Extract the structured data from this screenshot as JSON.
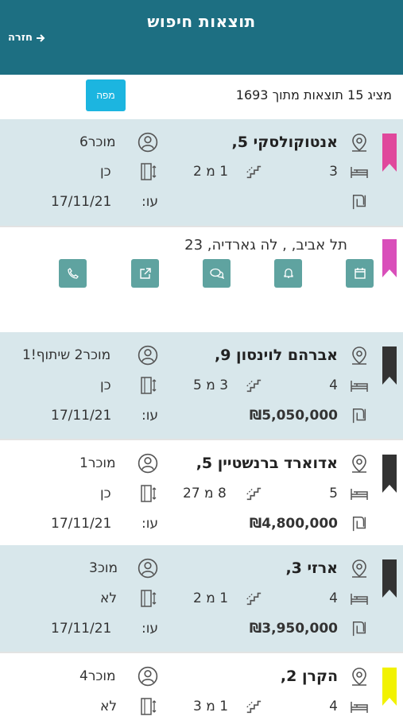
{
  "header": {
    "title": "תוצאות חיפוש",
    "back_label": "חזרה"
  },
  "summary": {
    "text": "מציג 15 תוצאות מתוך 1693",
    "map_label": "מפה"
  },
  "expanded": {
    "address": "תל אביב, , לה גארדיה, 23",
    "actions": [
      "calendar-icon",
      "bell-icon",
      "chat-icon",
      "external-link-icon",
      "phone-icon"
    ]
  },
  "listings": [
    {
      "address": "אנטוקולסקי 5,",
      "seller": "מוכר6",
      "rooms": "3",
      "floor": "1 מ 2",
      "parking": "כן",
      "price": "",
      "date": "17/11/21",
      "until": "עו:",
      "bookmark": "#e0489c"
    },
    {
      "address": "אברהם לוינסון 9,",
      "seller": "מוכר2 שיתוף!1",
      "rooms": "4",
      "floor": "3 מ 5",
      "parking": "כן",
      "price": "₪5,050,000",
      "date": "17/11/21",
      "until": "עו:",
      "bookmark": "#333333"
    },
    {
      "address": "אדוארד ברנשטיין 5,",
      "seller": "מוכר1",
      "rooms": "5",
      "floor": "8 מ 27",
      "parking": "כן",
      "price": "₪4,800,000",
      "date": "17/11/21",
      "until": "עו:",
      "bookmark": "#333333"
    },
    {
      "address": "ארזי 3,",
      "seller": "מוכ3",
      "rooms": "4",
      "floor": "1 מ 2",
      "parking": "לא",
      "price": "₪3,950,000",
      "date": "17/11/21",
      "until": "עו:",
      "bookmark": "#333333"
    },
    {
      "address": "הקרן 2,",
      "seller": "מוכר4",
      "rooms": "4",
      "floor": "1 מ 3",
      "parking": "לא",
      "price": "",
      "date": "",
      "until": "",
      "bookmark": "#f2f200"
    }
  ]
}
